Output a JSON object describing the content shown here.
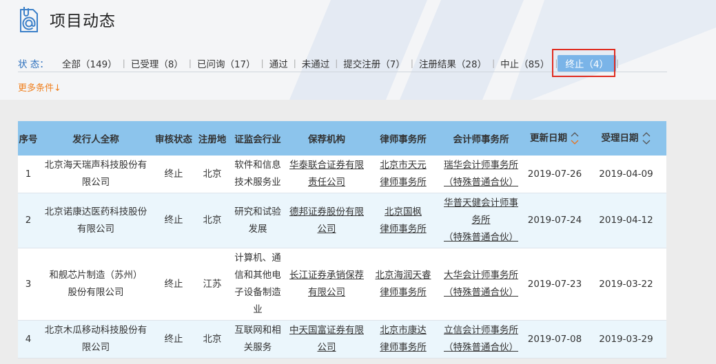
{
  "header": {
    "title": "项目动态",
    "icon": "document-at-icon"
  },
  "filter": {
    "label": "状  态：",
    "items": [
      {
        "label": "全部（149）"
      },
      {
        "label": "已受理（8）"
      },
      {
        "label": "已问询（17）"
      },
      {
        "label": "通过"
      },
      {
        "label": "未通过"
      },
      {
        "label": "提交注册（7）"
      },
      {
        "label": "注册结果（28）"
      },
      {
        "label": "中止（85）"
      },
      {
        "label": "终止（4）"
      }
    ],
    "active_index": 8,
    "more": "更多条件"
  },
  "table": {
    "columns": [
      "序号",
      "发行人全称",
      "审核状态",
      "注册地",
      "证监会行业",
      "保荐机构",
      "律师事务所",
      "会计师事务所",
      "更新日期",
      "受理日期"
    ],
    "rows": [
      {
        "no": "1",
        "issuer": [
          "北京海天瑞声科技股份有",
          "限公司"
        ],
        "status": "终止",
        "region": "北京",
        "industry": [
          "软件和信息",
          "技术服务业"
        ],
        "sponsor": [
          "华泰联合证券有限",
          "责任公司"
        ],
        "law": [
          "北京市天元",
          "律师事务所"
        ],
        "accountant": [
          "瑞华会计师事务所",
          "（特殊普通合伙）"
        ],
        "updated": "2019-07-26",
        "accepted": "2019-04-09"
      },
      {
        "no": "2",
        "issuer": [
          "北京诺康达医药科技股份",
          "有限公司"
        ],
        "status": "终止",
        "region": "北京",
        "industry": [
          "研究和试验",
          "发展"
        ],
        "sponsor": [
          "德邦证券股份有限",
          "公司"
        ],
        "law": [
          "北京国枫",
          "律师事务所"
        ],
        "accountant": [
          "华普天健会计师事",
          "务所",
          "（特殊普通合伙）"
        ],
        "updated": "2019-07-24",
        "accepted": "2019-04-12"
      },
      {
        "no": "3",
        "issuer": [
          "和舰芯片制造（苏州）",
          "股份有限公司"
        ],
        "status": "终止",
        "region": "江苏",
        "industry": [
          "计算机、通",
          "信和其他电",
          "子设备制造",
          "业"
        ],
        "sponsor": [
          "长江证券承销保荐",
          "有限公司"
        ],
        "law": [
          "北京海润天睿",
          "律师事务所"
        ],
        "accountant": [
          "大华会计师事务所",
          "（特殊普通合伙）"
        ],
        "updated": "2019-07-23",
        "accepted": "2019-03-22"
      },
      {
        "no": "4",
        "issuer": [
          "北京木瓜移动科技股份有",
          "限公司"
        ],
        "status": "终止",
        "region": "北京",
        "industry": [
          "互联网和相",
          "关服务"
        ],
        "sponsor": [
          "中天国富证券有限",
          "公司"
        ],
        "law": [
          "北京市康达",
          "律师事务所"
        ],
        "accountant": [
          "立信会计师事务所",
          "（特殊普通合伙）"
        ],
        "updated": "2019-07-08",
        "accepted": "2019-03-29"
      }
    ]
  },
  "colors": {
    "accent": "#2a6ebc",
    "header_bg": "#8cc4ec",
    "active": "#7ab4e8",
    "highlight": "#e02a1e",
    "more": "#f07f1e"
  }
}
